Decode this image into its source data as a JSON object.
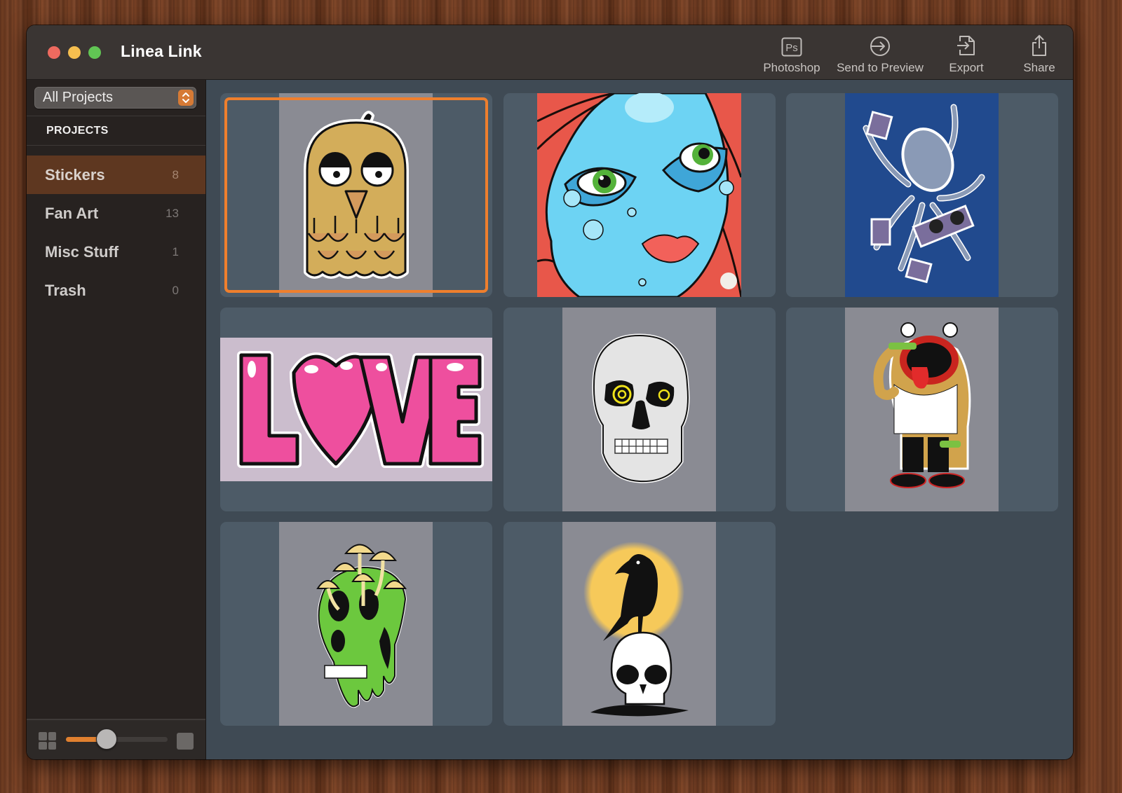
{
  "window": {
    "title": "Linea Link",
    "traffic_lights": [
      "close",
      "minimize",
      "zoom"
    ]
  },
  "toolbar": {
    "items": [
      {
        "label": "Photoshop",
        "icon": "photoshop-icon"
      },
      {
        "label": "Send to Preview",
        "icon": "send-to-preview-icon"
      },
      {
        "label": "Export",
        "icon": "export-icon"
      },
      {
        "label": "Share",
        "icon": "share-icon"
      }
    ]
  },
  "sidebar": {
    "filter": {
      "selected": "All Projects"
    },
    "section_header": "PROJECTS",
    "projects": [
      {
        "label": "Stickers",
        "count": "8",
        "active": true
      },
      {
        "label": "Fan Art",
        "count": "13",
        "active": false
      },
      {
        "label": "Misc Stuff",
        "count": "1",
        "active": false
      },
      {
        "label": "Trash",
        "count": "0",
        "active": false
      }
    ],
    "thumbnail_size": {
      "value": 0.4
    }
  },
  "gallery": {
    "selected_index": 0,
    "items": [
      {
        "subject": "Yellow owl sticker",
        "orientation": "portrait"
      },
      {
        "subject": "Blue face with red hair",
        "orientation": "square"
      },
      {
        "subject": "DJ octopus with speakers",
        "orientation": "portrait"
      },
      {
        "subject": "LOVE lettering sticker",
        "orientation": "landscape"
      },
      {
        "subject": "Skull with yellow eyes",
        "orientation": "portrait"
      },
      {
        "subject": "Frog drinking from bottle",
        "orientation": "portrait"
      },
      {
        "subject": "Green melting skull with mushrooms",
        "orientation": "portrait"
      },
      {
        "subject": "Crow on skull with moon",
        "orientation": "portrait"
      }
    ]
  },
  "colors": {
    "accent": "#ef7f2d",
    "sidebar_active": "#5e3720",
    "content_bg": "#3f4a54",
    "tile_bg": "#4d5b67"
  }
}
